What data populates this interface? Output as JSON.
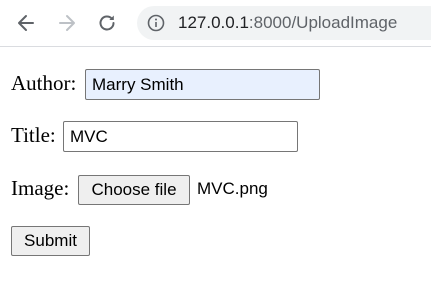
{
  "browser": {
    "url_host": "127.0.0.1",
    "url_rest": ":8000/UploadImage",
    "icons": {
      "back": "arrow-left-icon",
      "forward": "arrow-right-icon",
      "reload": "reload-icon",
      "info": "info-icon"
    }
  },
  "form": {
    "author_label": "Author:",
    "author_value": "Marry Smith",
    "title_label": "Title:",
    "title_value": "MVC",
    "image_label": "Image:",
    "choose_file_label": "Choose file",
    "chosen_file": "MVC.png",
    "submit_label": "Submit"
  },
  "colors": {
    "autofill_bg": "#e8f0fe",
    "omnibox_bg": "#f1f3f4",
    "button_bg": "#efefef"
  }
}
